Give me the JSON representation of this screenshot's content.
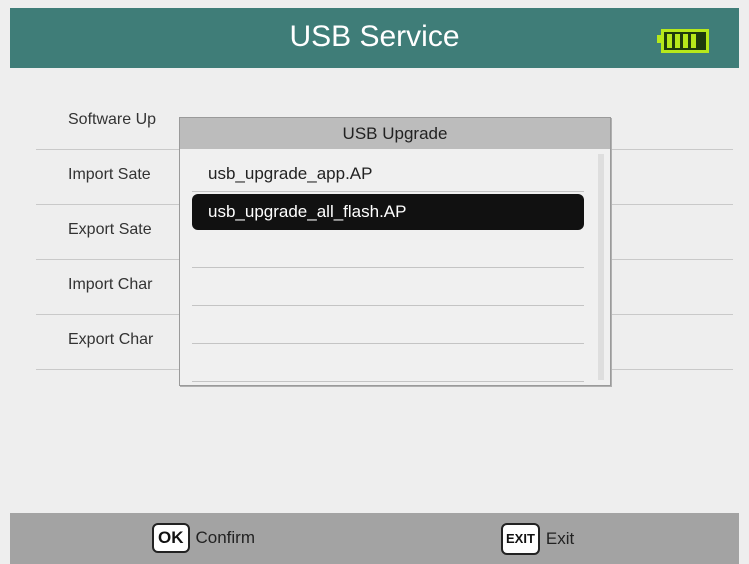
{
  "header": {
    "title": "USB Service"
  },
  "menu": {
    "items": [
      {
        "label": "Software Up"
      },
      {
        "label": "Import Sate"
      },
      {
        "label": "Export Sate"
      },
      {
        "label": "Import Char"
      },
      {
        "label": "Export Char"
      }
    ]
  },
  "popup": {
    "title": "USB Upgrade",
    "files": [
      {
        "name": "usb_upgrade_app.AP"
      },
      {
        "name": "usb_upgrade_all_flash.AP"
      },
      {
        "name": ""
      },
      {
        "name": ""
      },
      {
        "name": ""
      },
      {
        "name": ""
      }
    ],
    "selected_index": 1
  },
  "footer": {
    "ok_key": "OK",
    "ok_label": "Confirm",
    "exit_key": "EXIT",
    "exit_label": "Exit"
  },
  "colors": {
    "header_bg": "#3f7d78",
    "battery": "#b7e81a",
    "footer_bg": "#a3a3a3",
    "selection_bg": "#111111"
  },
  "icons": {
    "battery": "battery-full-icon"
  }
}
